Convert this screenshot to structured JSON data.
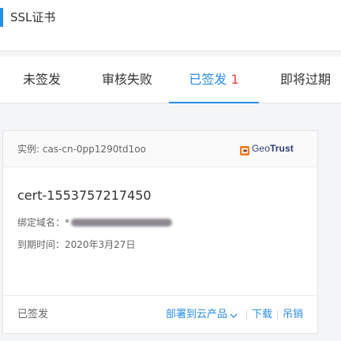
{
  "header": {
    "title": "SSL证书"
  },
  "tabs": [
    {
      "label": "未签发"
    },
    {
      "label": "审核失败"
    },
    {
      "label": "已签发",
      "count": "1",
      "active": true
    },
    {
      "label": "即将过期"
    }
  ],
  "card": {
    "instance": "实例: cas-cn-0pp1290td1oo",
    "brand": {
      "prefix": "Geo",
      "suffix": "Trust",
      "icon": "geotrust-logo-icon"
    },
    "cert_name": "cert-1553757217450",
    "domain_label": "绑定域名：*",
    "expire_label": "到期时间：2020年3月27日",
    "status": "已签发",
    "actions": {
      "deploy": "部署到云产品",
      "download": "下载",
      "revoke": "吊销"
    }
  },
  "colors": {
    "accent": "#2b8ee6",
    "count": "#e8453c"
  }
}
